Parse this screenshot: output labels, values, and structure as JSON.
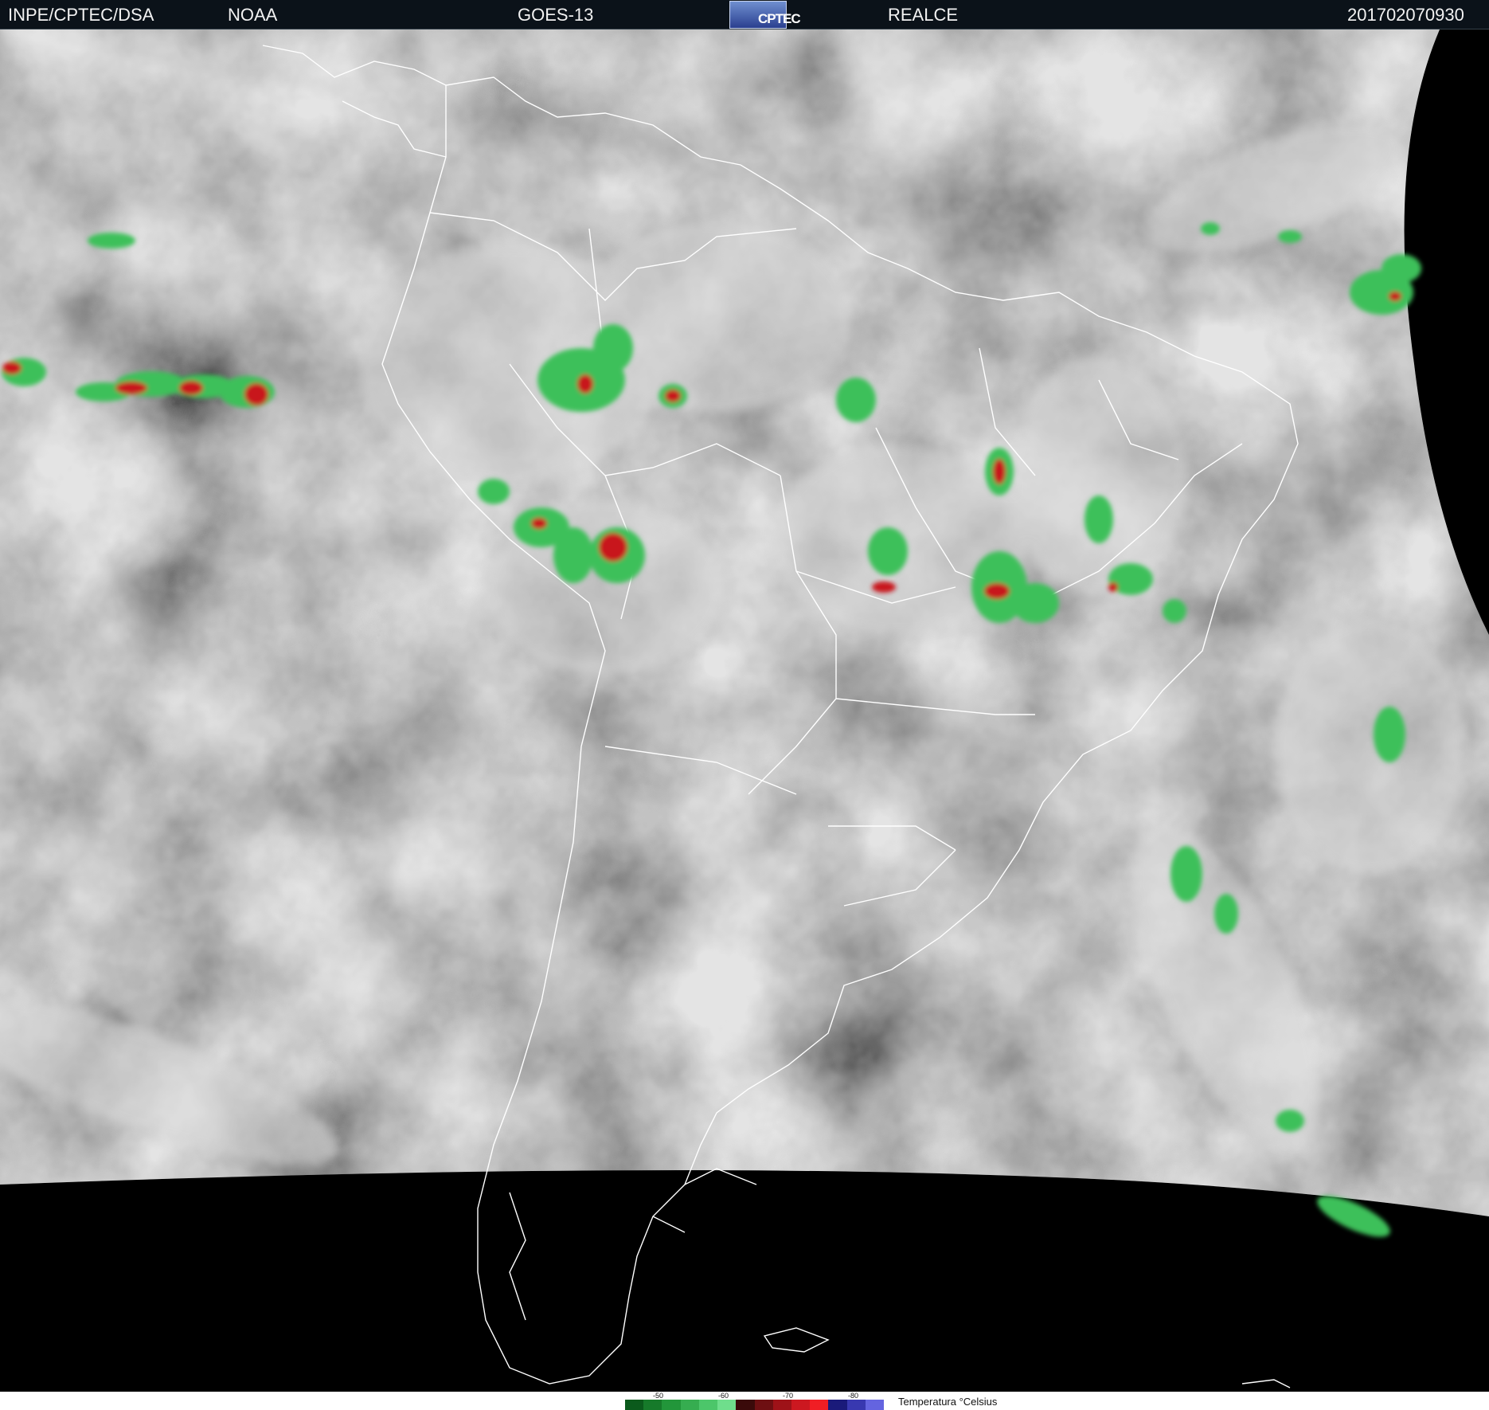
{
  "header": {
    "agency": "INPE/CPTEC/DSA",
    "noaa": "NOAA",
    "satellite": "GOES-13",
    "logo": "CPTEC",
    "mode": "REALCE",
    "timestamp": "201702070930"
  },
  "legend": {
    "title": "Temperatura °Celsius",
    "ticks": [
      "-50",
      "-60",
      "-70",
      "-80"
    ],
    "colors": [
      "#0b5a1c",
      "#167a2a",
      "#22963a",
      "#36ad50",
      "#4cc66a",
      "#6fde8c",
      "#3a0a0a",
      "#6e0f12",
      "#9e1218",
      "#cc1820",
      "#f01e24",
      "#1a1a7a",
      "#3838b0",
      "#6464e0"
    ]
  },
  "colors": {
    "header_bg": "#0b1219",
    "space": "#000000",
    "cloud_green": "#3cc05a",
    "cloud_red": "#c8141c"
  }
}
